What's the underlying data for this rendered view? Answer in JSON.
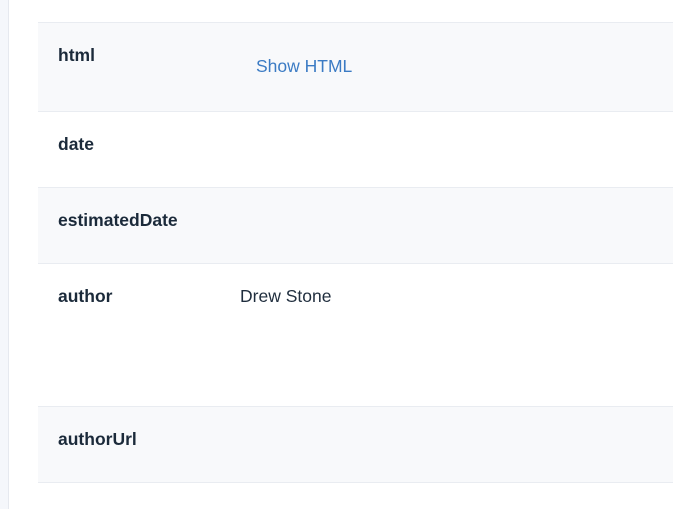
{
  "rows": [
    {
      "key": "html",
      "link_label": "Show HTML"
    },
    {
      "key": "date",
      "value": ""
    },
    {
      "key": "estimatedDate",
      "value": ""
    },
    {
      "key": "author",
      "value": "Drew Stone"
    },
    {
      "key": "authorUrl",
      "value": ""
    }
  ],
  "colors": {
    "link": "#3b7bc4",
    "row_shade": "#f8f9fb",
    "divider": "#e9ecf1",
    "text": "#1b2a3a"
  }
}
